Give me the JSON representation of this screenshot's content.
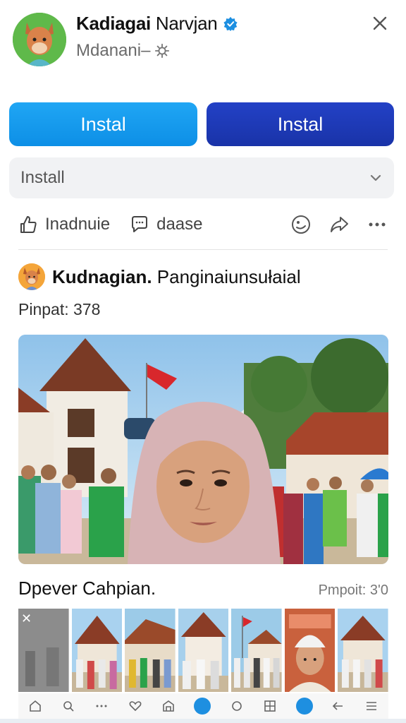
{
  "profile": {
    "name_bold": "Kadiagai",
    "name_rest": "Narvjan",
    "subtitle": "Mdanani–"
  },
  "buttons": {
    "left_label": "Instal",
    "right_label": "Instal"
  },
  "select": {
    "value": "Install"
  },
  "actions": {
    "like_label": "Inadnuie",
    "comment_label": "daase"
  },
  "post": {
    "title_bold": "Kudnagian.",
    "title_rest": "Panginaiunsułaial",
    "meta": "Pinpat: 378"
  },
  "caption": {
    "text": "Dpever Cahpian.",
    "meta": "Pmpoit: 3'0"
  },
  "colors": {
    "primary_blue": "#1a9bef",
    "dark_blue": "#1f3bb8",
    "verified": "#1d8fe1"
  }
}
